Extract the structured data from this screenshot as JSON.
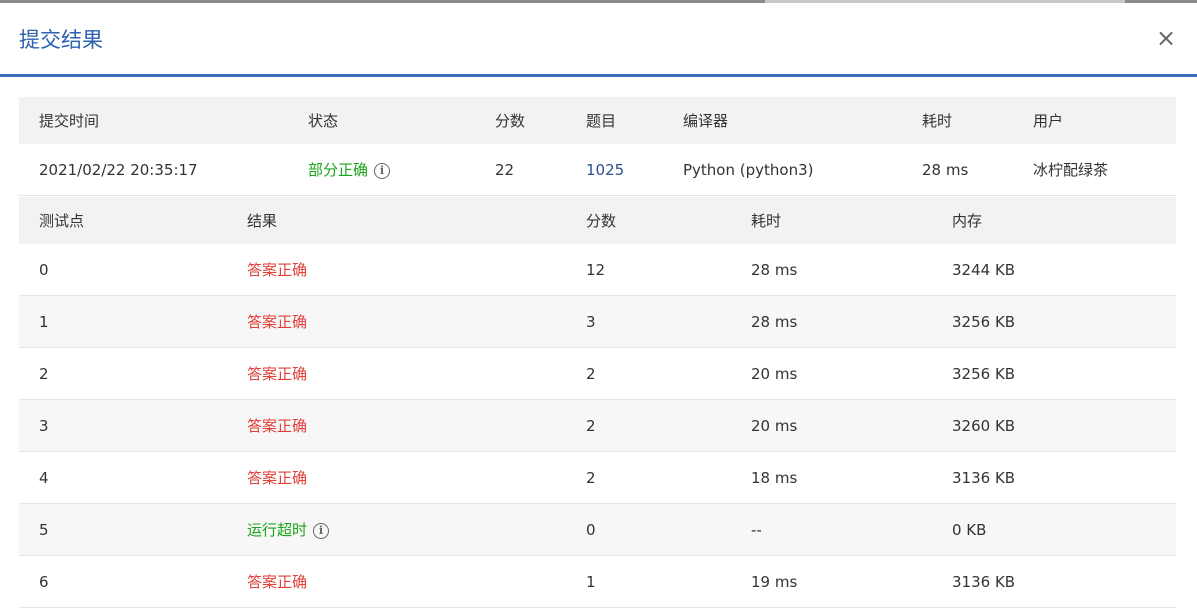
{
  "dialog": {
    "title": "提交结果",
    "close_label": "×"
  },
  "summary": {
    "headers": [
      "提交时间",
      "状态",
      "分数",
      "题目",
      "编译器",
      "耗时",
      "用户"
    ],
    "row": {
      "time": "2021/02/22 20:35:17",
      "status": "部分正确",
      "score": "22",
      "problem": "1025",
      "compiler": "Python (python3)",
      "elapsed": "28 ms",
      "user": "冰柠配绿茶"
    }
  },
  "cases": {
    "headers": [
      "测试点",
      "结果",
      "分数",
      "耗时",
      "内存"
    ],
    "rows": [
      {
        "id": "0",
        "result": "答案正确",
        "score": "12",
        "time": "28 ms",
        "memory": "3244 KB"
      },
      {
        "id": "1",
        "result": "答案正确",
        "score": "3",
        "time": "28 ms",
        "memory": "3256 KB"
      },
      {
        "id": "2",
        "result": "答案正确",
        "score": "2",
        "time": "20 ms",
        "memory": "3256 KB"
      },
      {
        "id": "3",
        "result": "答案正确",
        "score": "2",
        "time": "20 ms",
        "memory": "3260 KB"
      },
      {
        "id": "4",
        "result": "答案正确",
        "score": "2",
        "time": "18 ms",
        "memory": "3136 KB"
      },
      {
        "id": "5",
        "result": "运行超时",
        "score": "0",
        "time": "--",
        "memory": "0 KB"
      },
      {
        "id": "6",
        "result": "答案正确",
        "score": "1",
        "time": "19 ms",
        "memory": "3136 KB"
      }
    ]
  },
  "info_icon": "i",
  "colors": {
    "accent": "#2d62b0",
    "correct": "#e0403a",
    "partial": "#1aa51a",
    "link": "#2a4f8a"
  }
}
